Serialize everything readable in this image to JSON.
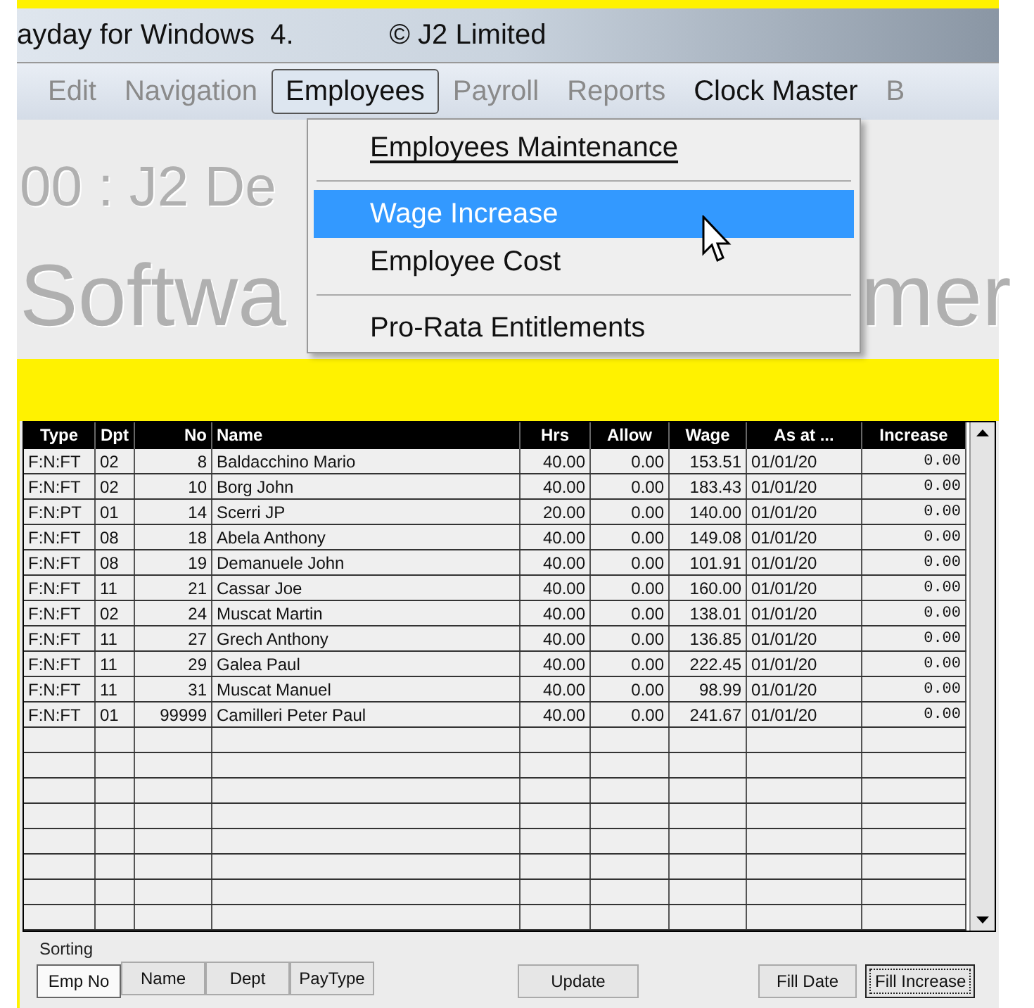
{
  "window": {
    "title": "ayday for Windows  4.",
    "copyright": "© J2 Limited"
  },
  "menu_bar": [
    {
      "label": "Edit",
      "disabled": true,
      "selected": false
    },
    {
      "label": "Navigation",
      "disabled": true,
      "selected": false
    },
    {
      "label": "Employees",
      "disabled": false,
      "selected": true
    },
    {
      "label": "Payroll",
      "disabled": true,
      "selected": false
    },
    {
      "label": "Reports",
      "disabled": true,
      "selected": false
    },
    {
      "label": "Clock Master",
      "disabled": false,
      "selected": false
    },
    {
      "label": "B",
      "disabled": true,
      "selected": false
    }
  ],
  "background_text": {
    "line_1": "00 : J2 De",
    "line_2_left": "Softwa",
    "line_2_right": "mer"
  },
  "dropdown": [
    {
      "kind": "item",
      "label": "Employees Maintenance",
      "mnemonic": true,
      "selected": false
    },
    {
      "kind": "separator"
    },
    {
      "kind": "item",
      "label": "Wage Increase",
      "mnemonic": false,
      "selected": true
    },
    {
      "kind": "item",
      "label": "Employee Cost",
      "mnemonic": false,
      "selected": false
    },
    {
      "kind": "separator"
    },
    {
      "kind": "item",
      "label": "Pro-Rata Entitlements",
      "mnemonic": false,
      "selected": false
    }
  ],
  "table": {
    "columns": [
      "Type",
      "Dpt",
      "No",
      "Name",
      "Hrs",
      "Allow",
      "Wage",
      "As at ...",
      "Increase"
    ],
    "rows": [
      [
        "F:N:FT",
        "02",
        "8",
        "Baldacchino Mario",
        "40.00",
        "0.00",
        "153.51",
        "01/01/20",
        "0.00"
      ],
      [
        "F:N:FT",
        "02",
        "10",
        "Borg John",
        "40.00",
        "0.00",
        "183.43",
        "01/01/20",
        "0.00"
      ],
      [
        "F:N:PT",
        "01",
        "14",
        "Scerri JP",
        "20.00",
        "0.00",
        "140.00",
        "01/01/20",
        "0.00"
      ],
      [
        "F:N:FT",
        "08",
        "18",
        "Abela Anthony",
        "40.00",
        "0.00",
        "149.08",
        "01/01/20",
        "0.00"
      ],
      [
        "F:N:FT",
        "08",
        "19",
        "Demanuele John",
        "40.00",
        "0.00",
        "101.91",
        "01/01/20",
        "0.00"
      ],
      [
        "F:N:FT",
        "11",
        "21",
        "Cassar Joe",
        "40.00",
        "0.00",
        "160.00",
        "01/01/20",
        "0.00"
      ],
      [
        "F:N:FT",
        "02",
        "24",
        "Muscat Martin",
        "40.00",
        "0.00",
        "138.01",
        "01/01/20",
        "0.00"
      ],
      [
        "F:N:FT",
        "11",
        "27",
        "Grech Anthony",
        "40.00",
        "0.00",
        "136.85",
        "01/01/20",
        "0.00"
      ],
      [
        "F:N:FT",
        "11",
        "29",
        "Galea Paul",
        "40.00",
        "0.00",
        "222.45",
        "01/01/20",
        "0.00"
      ],
      [
        "F:N:FT",
        "11",
        "31",
        "Muscat Manuel",
        "40.00",
        "0.00",
        "98.99",
        "01/01/20",
        "0.00"
      ],
      [
        "F:N:FT",
        "01",
        "99999",
        "Camilleri Peter Paul",
        "40.00",
        "0.00",
        "241.67",
        "01/01/20",
        "0.00"
      ]
    ]
  },
  "sorting": {
    "label": "Sorting",
    "buttons": [
      {
        "label": "Emp No",
        "selected": true
      },
      {
        "label": "Name",
        "selected": false
      },
      {
        "label": "Dept",
        "selected": false
      },
      {
        "label": "PayType",
        "selected": false
      }
    ]
  },
  "actions": [
    {
      "label": "Update",
      "focused": false
    },
    {
      "label": "Fill Date",
      "focused": false
    },
    {
      "label": "Fill Increase",
      "focused": true
    }
  ]
}
